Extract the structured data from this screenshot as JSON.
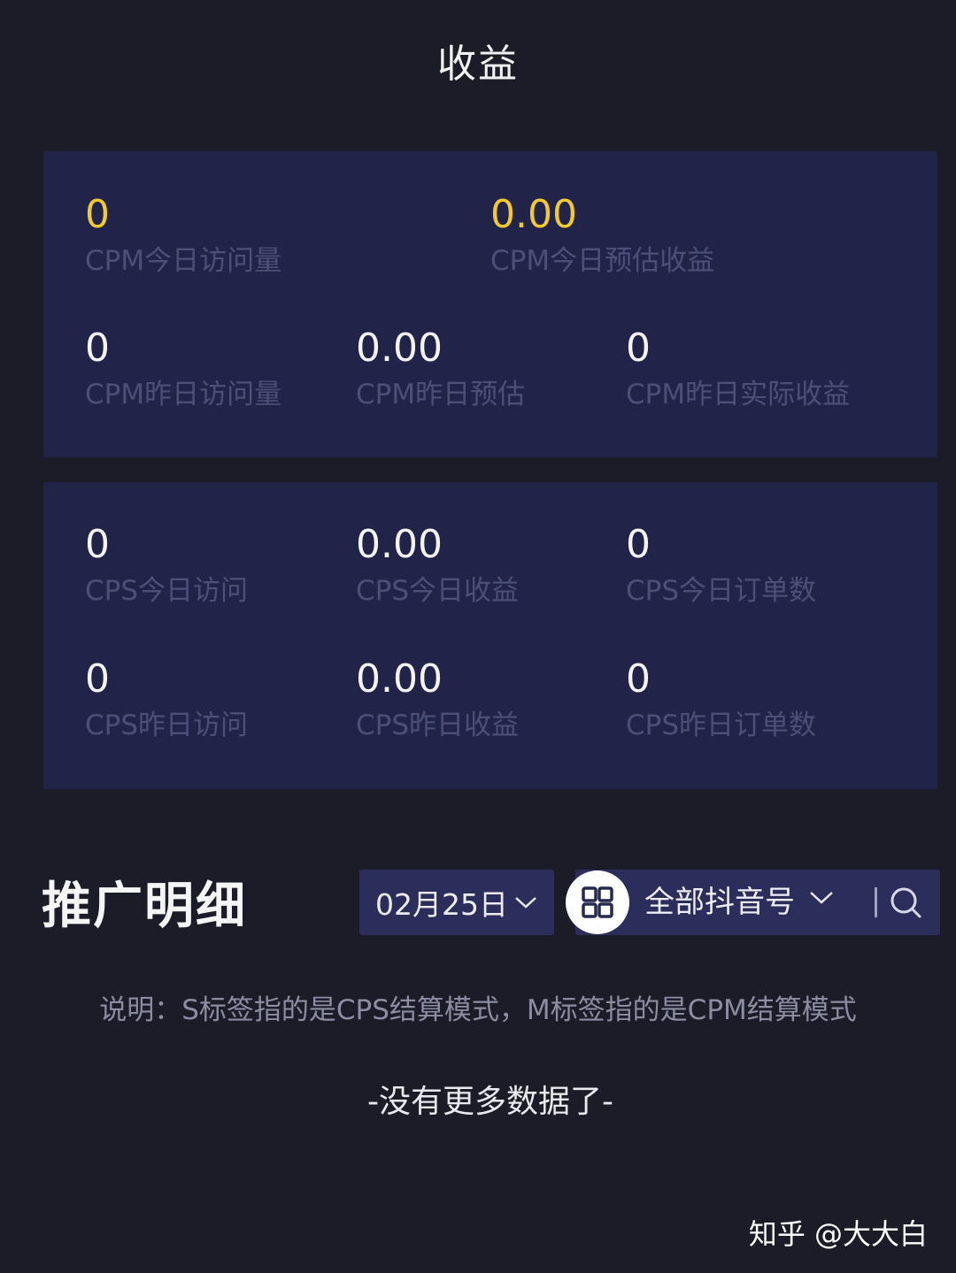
{
  "header": {
    "title": "收益"
  },
  "cpm_card": {
    "today_visits": {
      "value": "0",
      "label": "CPM今日访问量"
    },
    "today_estimated": {
      "value": "0.00",
      "label": "CPM今日预估收益"
    },
    "yesterday_visits": {
      "value": "0",
      "label": "CPM昨日访问量"
    },
    "yesterday_estimated": {
      "value": "0.00",
      "label": "CPM昨日预估"
    },
    "yesterday_actual": {
      "value": "0",
      "label": "CPM昨日实际收益"
    },
    "highlight_color": "#f3c92f"
  },
  "cps_card": {
    "today_visits": {
      "value": "0",
      "label": "CPS今日访问"
    },
    "today_revenue": {
      "value": "0.00",
      "label": "CPS今日收益"
    },
    "today_orders": {
      "value": "0",
      "label": "CPS今日订单数"
    },
    "yesterday_visits": {
      "value": "0",
      "label": "CPS昨日访问"
    },
    "yesterday_revenue": {
      "value": "0.00",
      "label": "CPS昨日收益"
    },
    "yesterday_orders": {
      "value": "0",
      "label": "CPS昨日订单数"
    }
  },
  "details": {
    "title": "推广明细",
    "date_filter": "02月25日",
    "account_filter": "全部抖音号",
    "grid_icon": "grid-icon",
    "search_icon": "search-icon",
    "note": "说明：S标签指的是CPS结算模式，M标签指的是CPM结算模式",
    "empty_text": "-没有更多数据了-"
  },
  "watermark": "知乎 @大大白"
}
